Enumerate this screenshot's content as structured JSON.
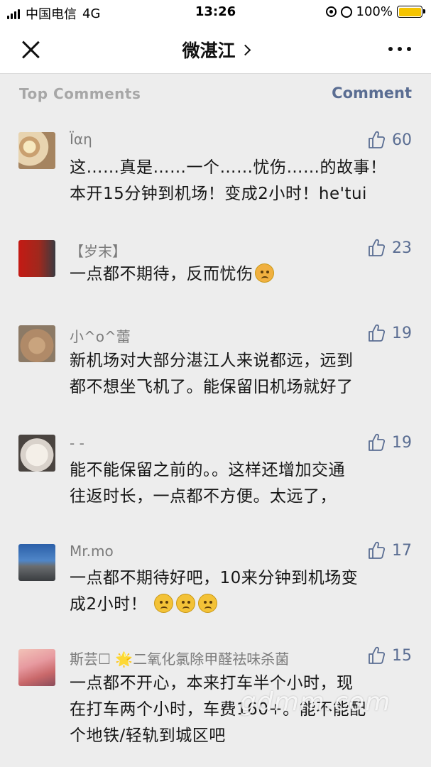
{
  "status_bar": {
    "carrier": "中国电信",
    "network": "4G",
    "time": "13:26",
    "battery": "100%"
  },
  "nav": {
    "title": "微湛江",
    "close_icon": "close-icon",
    "more_icon": "more-icon"
  },
  "section": {
    "title": "Top Comments",
    "action": "Comment"
  },
  "comments": [
    {
      "name": "Ïαη",
      "likes": "60",
      "line1": "这……真是……一个……忧伤……的故事！",
      "line2": "本开15分钟到机场！变成2小时！he'tui",
      "avatar": "flower"
    },
    {
      "name": "【岁末】",
      "likes": "23",
      "line1": "一点都不期待，反而忧伤",
      "line2": "",
      "avatar": "flag"
    },
    {
      "name": "小^o^蕾",
      "likes": "19",
      "line1": "新机场对大部分湛江人来说都远，远到",
      "line2": "都不想坐飞机了。能保留旧机场就好了",
      "avatar": "hands"
    },
    {
      "name": "- -",
      "likes": "19",
      "line1": "能不能保留之前的。。这样还增加交通",
      "line2": "往返时长，一点都不方便。太远了，",
      "avatar": "cartoon"
    },
    {
      "name": "Mr.mo",
      "likes": "17",
      "line1": "一点都不期待好吧，10来分钟到机场变",
      "line2": "成2小时！",
      "avatar": "sea"
    },
    {
      "name": "斯芸☐ 🌟二氧化氯除甲醛祛味杀菌",
      "likes": "15",
      "line1": "一点都不开心，本来打车半个小时，现",
      "line2": "在打车两个小时，车费160+。能不能配",
      "line3": "个地铁/轻轨到城区吧",
      "avatar": "anime"
    }
  ],
  "watermark": "gdmm.com",
  "colors": {
    "accent": "#5a6d92",
    "background": "#ededed",
    "battery": "#f5c400"
  }
}
